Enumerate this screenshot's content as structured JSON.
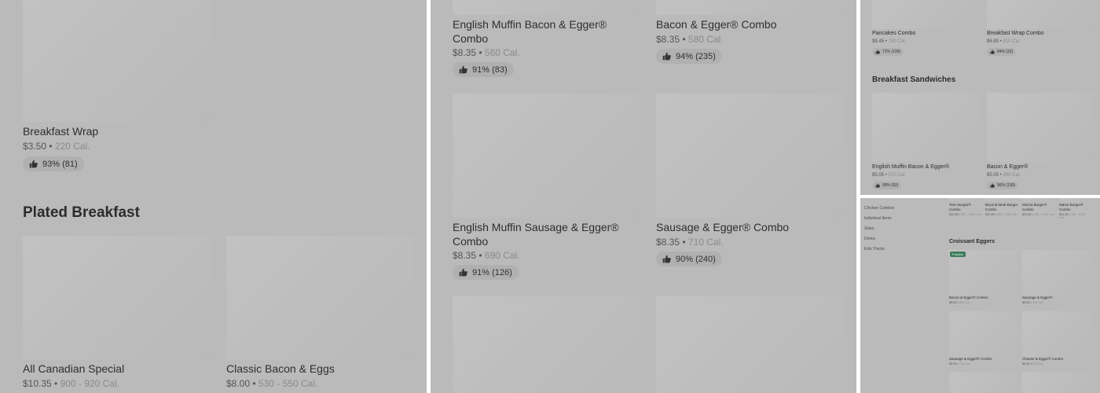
{
  "panel1": {
    "item_breakfast_wrap": {
      "name": "Breakfast Wrap",
      "price": "$3.50",
      "cal": "220 Cal.",
      "rating": "93% (81)"
    },
    "section_title": "Plated Breakfast",
    "item_all_canadian": {
      "name": "All Canadian Special",
      "price": "$10.35",
      "cal": "900 - 920 Cal."
    },
    "item_classic": {
      "name": "Classic Bacon & Eggs",
      "price": "$8.00",
      "cal": "530 - 550 Cal."
    }
  },
  "panel2": {
    "item_em_bacon_combo": {
      "name": "English Muffin Bacon & Egger® Combo",
      "price": "$8.35",
      "cal": "560 Cal.",
      "rating": "91% (83)"
    },
    "item_bacon_combo": {
      "name": "Bacon & Egger® Combo",
      "price": "$8.35",
      "cal": "580 Cal.",
      "rating": "94% (235)"
    },
    "item_em_sausage_combo": {
      "name": "English Muffin Sausage & Egger® Combo",
      "price": "$8.35",
      "cal": "690 Cal.",
      "rating": "91% (126)"
    },
    "item_sausage_combo": {
      "name": "Sausage & Egger® Combo",
      "price": "$8.35",
      "cal": "710 Cal.",
      "rating": "90% (240)"
    }
  },
  "panel3": {
    "item_pancakes_combo": {
      "name": "Pancakes Combo",
      "price": "$8.45",
      "cal": "780 Cal.",
      "rating": "71% (100)"
    },
    "item_breakfast_wrap_combo": {
      "name": "Breakfast Wrap Combo",
      "price": "$6.80",
      "cal": "410 Cal.",
      "rating": "84% (32)"
    },
    "section_title": "Breakfast Sandwiches",
    "item_em_bacon": {
      "name": "English Muffin Bacon & Egger®",
      "price": "$5.05",
      "cal": "370 Cal.",
      "rating": "90% (92)"
    },
    "item_bacon": {
      "name": "Bacon & Egger®",
      "price": "$5.05",
      "cal": "390 Cal.",
      "rating": "96% (130)"
    }
  },
  "panel4": {
    "sidebar": [
      "Chicken Combos",
      "Individual Items",
      "Sides",
      "Drinks",
      "Kids' Packs"
    ],
    "top_items": [
      {
        "name": "Teen Burger® Combo",
        "price": "$12.85",
        "cal": "900 - 1220 Cal."
      },
      {
        "name": "Beyond Meat Burger Combo",
        "price": "$12.85",
        "cal": "860 - 1200 Cal."
      },
      {
        "name": "Mozza Burger® Combo",
        "price": "$12.85",
        "cal": "960 - 1210 Cal."
      },
      {
        "name": "Mama Burger® Combo",
        "price": "$11.35",
        "cal": "790 - 1020 Cal."
      }
    ],
    "section_title": "Croissant Eggers",
    "badge": "Popular",
    "items": [
      {
        "name": "Bacon & Egger® Combo",
        "price": "$9.84",
        "cal": "800 Cal."
      },
      {
        "name": "Sausage & Egger®",
        "price": "$6.59",
        "cal": "540 Cal."
      },
      {
        "name": "Sausage & Egger® Combo",
        "price": "$9.84",
        "cal": "710 Cal."
      },
      {
        "name": "Cheese & Egger® Combo",
        "price": "$8.59",
        "cal": "540 Cal."
      }
    ]
  },
  "colors": {
    "overlay": "#bababa",
    "placeholder": "#c0c0c0",
    "divider": "#ffffff",
    "popular_badge": "#3e7b5a"
  }
}
